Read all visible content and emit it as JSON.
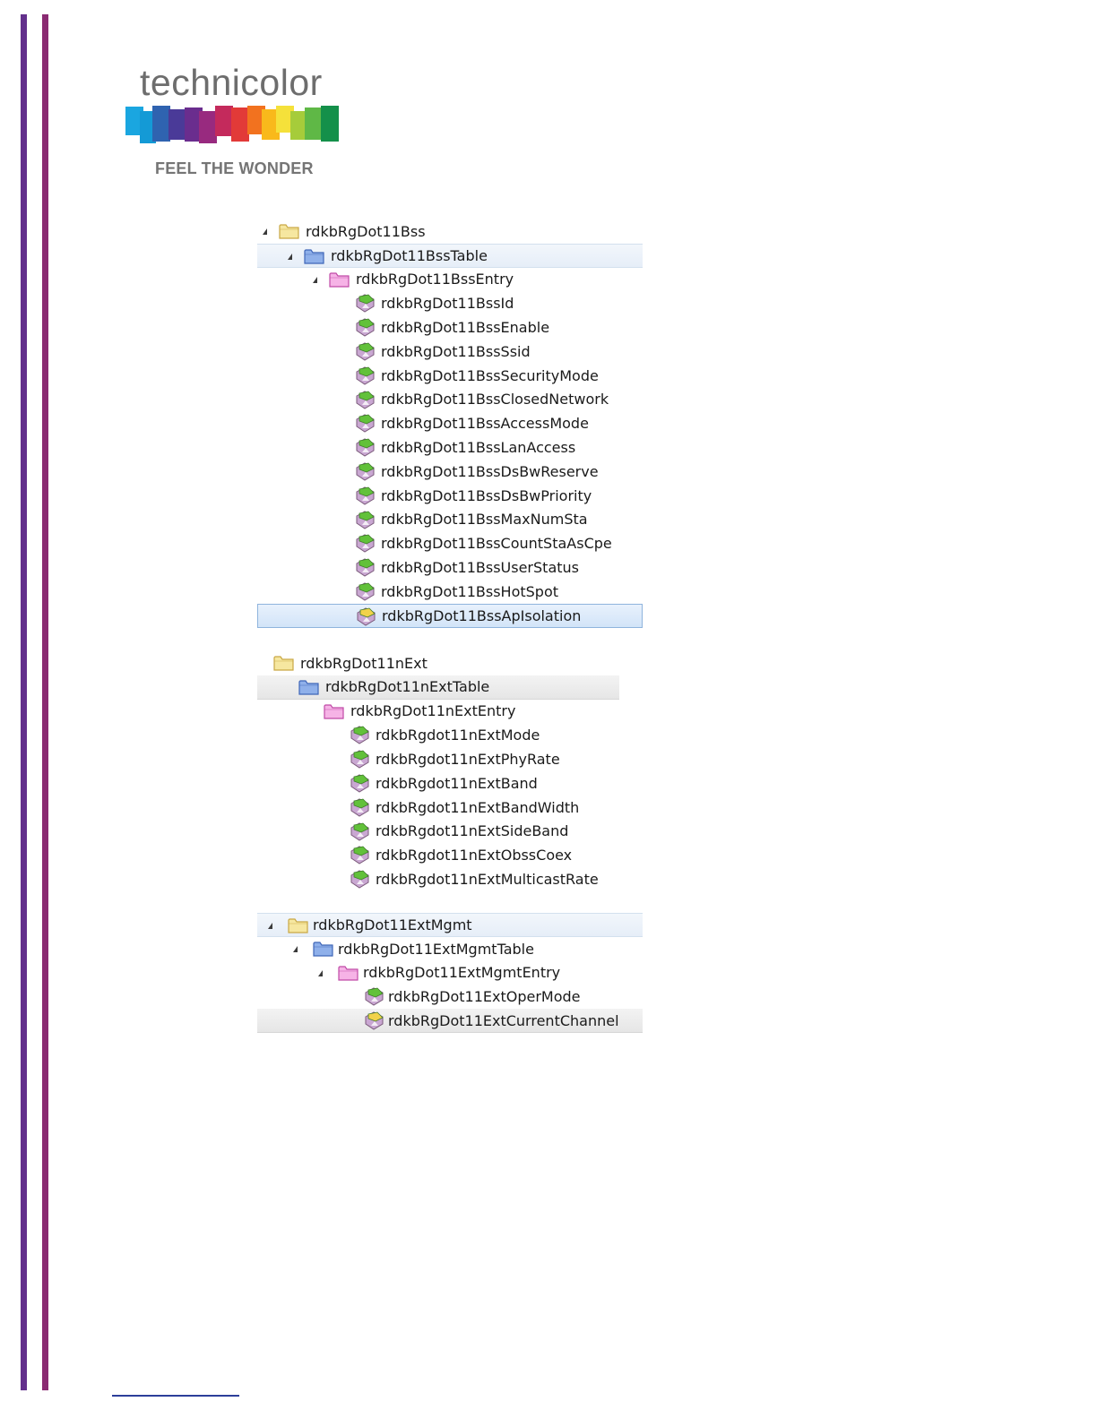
{
  "logo": {
    "wordmark": "technicolor",
    "tagline": "FEEL THE WONDER"
  },
  "trees": [
    {
      "id": "bss",
      "rows": [
        {
          "label": "rdkbRgDot11Bss",
          "level": 0,
          "icon": "folder-yellow-icon",
          "expander": true,
          "style": ""
        },
        {
          "label": "rdkbRgDot11BssTable",
          "level": 1,
          "icon": "folder-blue-icon",
          "expander": true,
          "style": "hl"
        },
        {
          "label": "rdkbRgDot11BssEntry",
          "level": 2,
          "icon": "folder-pink-icon",
          "expander": true,
          "style": ""
        },
        {
          "label": "rdkbRgDot11BssId",
          "level": 3,
          "icon": "leaf-green-icon",
          "expander": false,
          "style": ""
        },
        {
          "label": "rdkbRgDot11BssEnable",
          "level": 3,
          "icon": "leaf-green-icon",
          "expander": false,
          "style": ""
        },
        {
          "label": "rdkbRgDot11BssSsid",
          "level": 3,
          "icon": "leaf-green-icon",
          "expander": false,
          "style": ""
        },
        {
          "label": "rdkbRgDot11BssSecurityMode",
          "level": 3,
          "icon": "leaf-green-icon",
          "expander": false,
          "style": ""
        },
        {
          "label": "rdkbRgDot11BssClosedNetwork",
          "level": 3,
          "icon": "leaf-green-icon",
          "expander": false,
          "style": ""
        },
        {
          "label": "rdkbRgDot11BssAccessMode",
          "level": 3,
          "icon": "leaf-green-icon",
          "expander": false,
          "style": ""
        },
        {
          "label": "rdkbRgDot11BssLanAccess",
          "level": 3,
          "icon": "leaf-green-icon",
          "expander": false,
          "style": ""
        },
        {
          "label": "rdkbRgDot11BssDsBwReserve",
          "level": 3,
          "icon": "leaf-green-icon",
          "expander": false,
          "style": ""
        },
        {
          "label": "rdkbRgDot11BssDsBwPriority",
          "level": 3,
          "icon": "leaf-green-icon",
          "expander": false,
          "style": ""
        },
        {
          "label": "rdkbRgDot11BssMaxNumSta",
          "level": 3,
          "icon": "leaf-green-icon",
          "expander": false,
          "style": ""
        },
        {
          "label": "rdkbRgDot11BssCountStaAsCpe",
          "level": 3,
          "icon": "leaf-green-icon",
          "expander": false,
          "style": ""
        },
        {
          "label": "rdkbRgDot11BssUserStatus",
          "level": 3,
          "icon": "leaf-green-icon",
          "expander": false,
          "style": ""
        },
        {
          "label": "rdkbRgDot11BssHotSpot",
          "level": 3,
          "icon": "leaf-green-icon",
          "expander": false,
          "style": ""
        },
        {
          "label": "rdkbRgDot11BssApIsolation",
          "level": 3,
          "icon": "leaf-yellow-icon",
          "expander": false,
          "style": "sel"
        }
      ]
    },
    {
      "id": "next",
      "rows": [
        {
          "label": "rdkbRgDot11nExt",
          "level": 0,
          "icon": "folder-yellow-icon",
          "expander": false,
          "style": ""
        },
        {
          "label": "rdkbRgDot11nExtTable",
          "level": 1,
          "icon": "folder-blue-icon",
          "expander": false,
          "style": "gray"
        },
        {
          "label": "rdkbRgDot11nExtEntry",
          "level": 2,
          "icon": "folder-pink-icon",
          "expander": false,
          "style": ""
        },
        {
          "label": "rdkbRgdot11nExtMode",
          "level": 3,
          "icon": "leaf-green-icon",
          "expander": false,
          "style": ""
        },
        {
          "label": "rdkbRgdot11nExtPhyRate",
          "level": 3,
          "icon": "leaf-green-icon",
          "expander": false,
          "style": ""
        },
        {
          "label": "rdkbRgdot11nExtBand",
          "level": 3,
          "icon": "leaf-green-icon",
          "expander": false,
          "style": ""
        },
        {
          "label": "rdkbRgdot11nExtBandWidth",
          "level": 3,
          "icon": "leaf-green-icon",
          "expander": false,
          "style": ""
        },
        {
          "label": "rdkbRgdot11nExtSideBand",
          "level": 3,
          "icon": "leaf-green-icon",
          "expander": false,
          "style": ""
        },
        {
          "label": "rdkbRgdot11nExtObssCoex",
          "level": 3,
          "icon": "leaf-green-icon",
          "expander": false,
          "style": ""
        },
        {
          "label": "rdkbRgdot11nExtMulticastRate",
          "level": 3,
          "icon": "leaf-green-icon",
          "expander": false,
          "style": ""
        }
      ]
    },
    {
      "id": "extmgmt",
      "rows": [
        {
          "label": "rdkbRgDot11ExtMgmt",
          "level": 0,
          "icon": "folder-yellow-icon",
          "expander": true,
          "style": "hl"
        },
        {
          "label": "rdkbRgDot11ExtMgmtTable",
          "level": 1,
          "icon": "folder-blue-icon",
          "expander": true,
          "style": ""
        },
        {
          "label": "rdkbRgDot11ExtMgmtEntry",
          "level": 2,
          "icon": "folder-pink-icon",
          "expander": true,
          "style": ""
        },
        {
          "label": "rdkbRgDot11ExtOperMode",
          "level": 3,
          "icon": "leaf-green-icon",
          "expander": false,
          "style": ""
        },
        {
          "label": "rdkbRgDot11ExtCurrentChannel",
          "level": 3,
          "icon": "leaf-yellow-icon",
          "expander": false,
          "style": "gray"
        }
      ]
    }
  ]
}
